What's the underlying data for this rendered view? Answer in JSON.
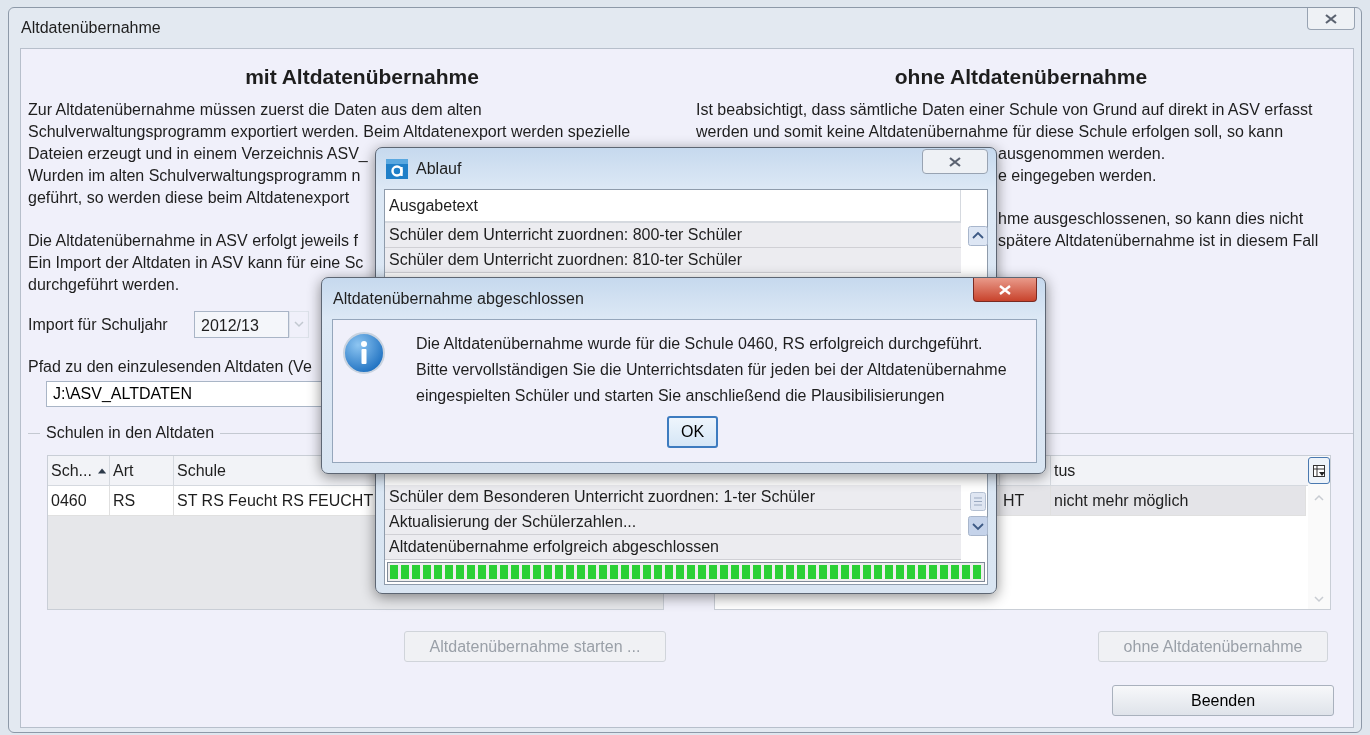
{
  "window": {
    "title": "Altdatenübernahme"
  },
  "sections": [
    {
      "heading": "mit Altdatenübernahme",
      "paragraphs": [
        [
          {
            "text": "Zur Altdatenübernahme müssen zuerst die Daten aus dem alten"
          },
          {
            "text": "Schulverwaltungsprogramm exportiert werden. Beim Altdatenexport werden spezielle"
          },
          {
            "text": "Dateien erzeugt und in einem Verzeichnis ASV_"
          },
          {
            "text": "Wurden im alten Schulverwaltungsprogramm n"
          },
          {
            "text": "geführt, so werden diese beim Altdatenexport"
          }
        ],
        [
          {
            "text": "Die Altdatenübernahme in ASV erfolgt jeweils f"
          },
          {
            "text": "Ein Import der Altdaten in ASV kann für eine Sc"
          },
          {
            "text": "durchgeführt werden."
          }
        ]
      ]
    },
    {
      "heading": "ohne Altdatenübernahme",
      "paragraphs": [
        [
          {
            "text": "Ist beabsichtigt, dass sämtliche Daten einer Schule von Grund auf direkt in ASV erfasst",
            "clipped_start": false
          },
          {
            "text": "werden und somit keine Altdatenübernahme für diese Schule erfolgen soll, so kann",
            "clipped_start": false
          },
          {
            "text": "ausgenommen werden.",
            "clipped_start": true
          },
          {
            "text": "e eingegeben werden.",
            "clipped_start": true
          }
        ],
        [
          {
            "text": "hme ausgeschlossenen, so kann dies nicht",
            "clipped_start": true
          },
          {
            "text": "spätere Altdatenübernahme ist in diesem Fall",
            "clipped_start": true
          }
        ]
      ]
    }
  ],
  "import_year": {
    "label": "Import für Schuljahr",
    "value": "2012/13",
    "disabled": true
  },
  "path": {
    "label": "Pfad zu den einzulesenden Altdaten (Ve",
    "value": "J:\\ASV_ALTDATEN"
  },
  "schools_group": {
    "title": "Schulen in den Altdaten",
    "left_table": {
      "columns": [
        {
          "label": "Sch...",
          "sorted": true
        },
        {
          "label": "Art",
          "sorted": false
        },
        {
          "label": "Schule",
          "sorted": false
        }
      ],
      "rows": [
        {
          "cells": [
            "0460",
            "RS",
            "ST RS Feucht RS FEUCHT"
          ],
          "selected": false
        }
      ]
    },
    "right_table": {
      "columns": [
        "",
        "tus"
      ],
      "rows": [
        {
          "cells": [
            "HT",
            "nicht mehr möglich"
          ],
          "selected": true
        }
      ]
    }
  },
  "buttons": [
    {
      "label": "Altdatenübernahme starten ...",
      "disabled": true,
      "kind": "start"
    },
    {
      "label": "ohne Altdatenübernahme",
      "disabled": true,
      "kind": "without"
    },
    {
      "label": "Beenden",
      "disabled": false,
      "kind": "close"
    }
  ],
  "progress_dialog": {
    "title": "Ablauf",
    "column": "Ausgabetext",
    "rows_above": [
      "Schüler dem Unterricht zuordnen: 800-ter Schüler",
      "Schüler dem Unterricht zuordnen: 810-ter Schüler"
    ],
    "rows_below": [
      "Schüler dem Besonderen Unterricht zuordnen: 1-ter Schüler",
      "Aktualisierung der Schülerzahlen...",
      "Altdatenübernahme erfolgreich abgeschlossen"
    ],
    "progress": {
      "level": 1
    }
  },
  "message_dialog": {
    "title": "Altdatenübernahme abgeschlossen",
    "lines": [
      "Die Altdatenübernahme wurde für die Schule 0460, RS erfolgreich durchgeführt.",
      "Bitte vervollständigen Sie die Unterrichtsdaten für jeden bei der Altdatenübernahme",
      "eingespielten Schüler und starten Sie anschließend die Plausibilisierungen"
    ],
    "button": "OK"
  }
}
